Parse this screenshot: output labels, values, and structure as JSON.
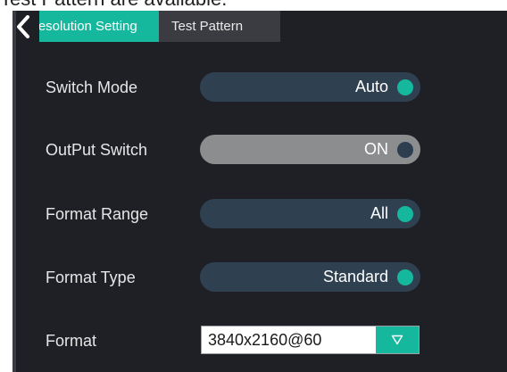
{
  "caption": "Test Pattern are available.",
  "tabs": [
    {
      "label": "Resolution Setting",
      "active": true
    },
    {
      "label": "Test Pattern",
      "active": false
    }
  ],
  "rows": [
    {
      "label": "Switch Mode",
      "value": "Auto",
      "state": "on"
    },
    {
      "label": "OutPut Switch",
      "value": "ON",
      "state": "off"
    },
    {
      "label": "Format Range",
      "value": "All",
      "state": "on"
    },
    {
      "label": "Format Type",
      "value": "Standard",
      "state": "on"
    }
  ],
  "format": {
    "label": "Format",
    "value": "3840x2160@60",
    "dropdown_icon": "triangle-down-icon"
  },
  "icons": {
    "back": "chevron-left-icon"
  },
  "colors": {
    "accent": "#16b89d",
    "panel_bg": "#1e2026",
    "pill_bg": "#2f4151",
    "pill_grey": "#8c8d8f",
    "tab_inactive": "#3a3c42"
  }
}
